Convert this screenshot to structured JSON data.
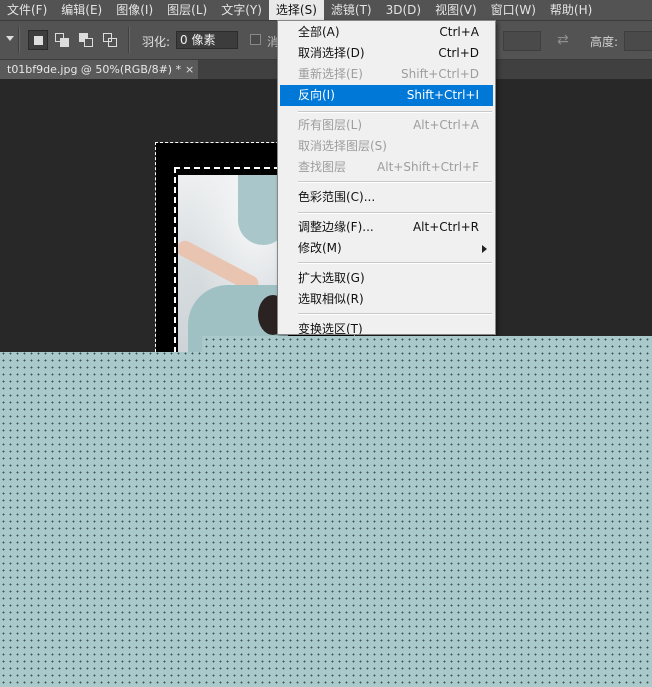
{
  "menubar": {
    "items": [
      {
        "label": "文件(F)"
      },
      {
        "label": "编辑(E)"
      },
      {
        "label": "图像(I)"
      },
      {
        "label": "图层(L)"
      },
      {
        "label": "文字(Y)"
      },
      {
        "label": "选择(S)"
      },
      {
        "label": "滤镜(T)"
      },
      {
        "label": "3D(D)"
      },
      {
        "label": "视图(V)"
      },
      {
        "label": "窗口(W)"
      },
      {
        "label": "帮助(H)"
      }
    ]
  },
  "options": {
    "feather_label": "羽化:",
    "feather_value": "0 像素",
    "antialias_label": "消",
    "height_label": "高度:"
  },
  "document": {
    "tab_title": "t01bf9de.jpg @ 50%(RGB/8#) *",
    "tab_close": "×"
  },
  "select_menu": {
    "items": [
      {
        "label": "全部(A)",
        "shortcut": "Ctrl+A"
      },
      {
        "label": "取消选择(D)",
        "shortcut": "Ctrl+D"
      },
      {
        "label": "重新选择(E)",
        "shortcut": "Shift+Ctrl+D"
      },
      {
        "label": "反向(I)",
        "shortcut": "Shift+Ctrl+I"
      },
      {
        "label": "所有图层(L)",
        "shortcut": "Alt+Ctrl+A"
      },
      {
        "label": "取消选择图层(S)",
        "shortcut": ""
      },
      {
        "label": "查找图层",
        "shortcut": "Alt+Shift+Ctrl+F"
      },
      {
        "label": "色彩范围(C)...",
        "shortcut": ""
      },
      {
        "label": "调整边缘(F)...",
        "shortcut": "Alt+Ctrl+R"
      },
      {
        "label": "修改(M)",
        "shortcut": ""
      },
      {
        "label": "扩大选取(G)",
        "shortcut": ""
      },
      {
        "label": "选取相似(R)",
        "shortcut": ""
      },
      {
        "label": "变换选区(T)",
        "shortcut": ""
      }
    ]
  }
}
